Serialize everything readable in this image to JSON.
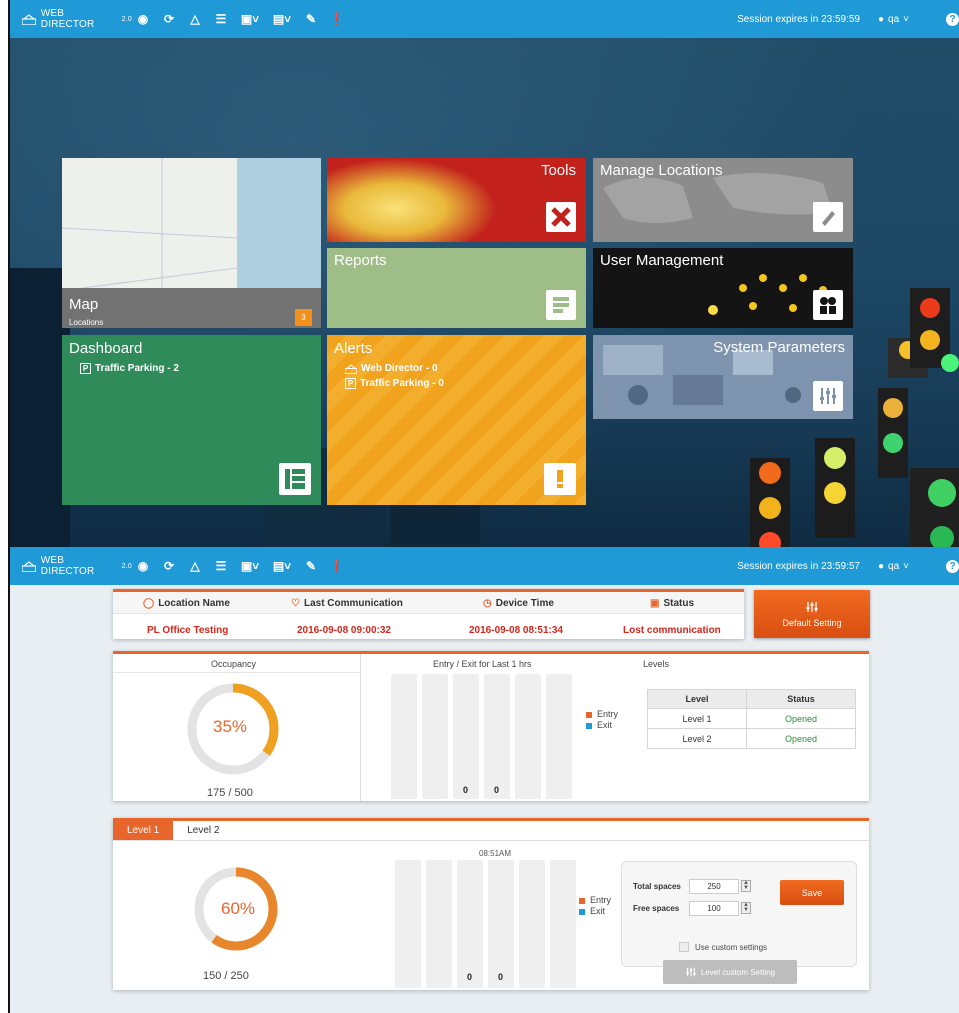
{
  "topbar": {
    "brand": "WEB DIRECTOR",
    "version": "2.0",
    "session_top": "Session expires in 23:59:59",
    "session_bottom": "Session expires in 23:59:57",
    "user": "qa",
    "toolbar_icons": [
      "back-icon",
      "refresh-icon",
      "map-pin-icon",
      "list-icon",
      "image-dropdown-icon",
      "report-dropdown-icon",
      "edit-icon",
      "alert-icon"
    ]
  },
  "tiles": {
    "map": {
      "title": "Map",
      "subtitle": "Locations",
      "badge": "3"
    },
    "tools": {
      "title": "Tools"
    },
    "manage_locations": {
      "title": "Manage Locations"
    },
    "reports": {
      "title": "Reports"
    },
    "user_management": {
      "title": "User Management"
    },
    "dashboard": {
      "title": "Dashboard",
      "items": [
        "Traffic Parking - 2"
      ]
    },
    "alerts": {
      "title": "Alerts",
      "items": [
        "Web Director - 0",
        "Traffic Parking - 0"
      ]
    },
    "system_parameters": {
      "title": "System Parameters"
    }
  },
  "info": {
    "headers": [
      "Location Name",
      "Last Communication",
      "Device Time",
      "Status"
    ],
    "values": [
      "PL Office Testing",
      "2016-09-08 09:00:32",
      "2016-09-08 08:51:34",
      "Lost communication"
    ],
    "default_setting": "Default Setting"
  },
  "occupancy": {
    "title": "Occupancy",
    "percent_label": "35%",
    "percent": 0.35,
    "ratio": "175 / 500",
    "entry_exit_title": "Entry / Exit for Last 1 hrs",
    "bar_labels": [
      "0",
      "0"
    ],
    "legend": [
      "Entry",
      "Exit"
    ],
    "levels_title": "Levels",
    "levels_headers": [
      "Level",
      "Status"
    ],
    "levels_rows": [
      [
        "Level 1",
        "Opened"
      ],
      [
        "Level 2",
        "Opened"
      ]
    ]
  },
  "level_panel": {
    "tabs": [
      "Level 1",
      "Level 2"
    ],
    "percent_label": "60%",
    "percent": 0.6,
    "ratio": "150 / 250",
    "time": "08:51AM",
    "bar_labels": [
      "0",
      "0"
    ],
    "legend": [
      "Entry",
      "Exit"
    ],
    "total_spaces_label": "Total spaces",
    "total_spaces": "250",
    "free_spaces_label": "Free spaces",
    "free_spaces": "100",
    "save": "Save",
    "use_custom": "Use custom settings",
    "level_custom_setting": "Level custom Setting"
  },
  "colors": {
    "accent": "#e8662b",
    "topbar": "#1f9ad6",
    "entry": "#e8662b",
    "exit": "#1f9ad6"
  }
}
